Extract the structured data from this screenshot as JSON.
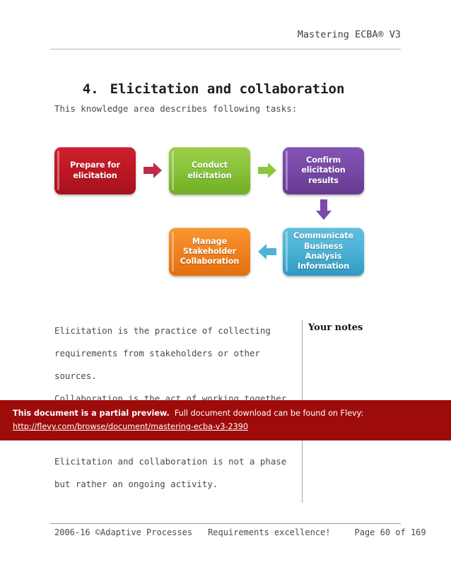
{
  "header": {
    "title": "Mastering ECBA® V3"
  },
  "heading": {
    "number": "4.",
    "text": "Elicitation and collaboration"
  },
  "intro": "This knowledge area describes following tasks:",
  "diagram": {
    "nodes": [
      {
        "id": "prepare-for-elicitation",
        "label": "Prepare for\nelicitation",
        "color": "#c21824"
      },
      {
        "id": "conduct-elicitation",
        "label": "Conduct\nelicitation",
        "color": "#8cc63f"
      },
      {
        "id": "confirm-elicitation-results",
        "label": "Confirm\nelicitation results",
        "color": "#7a4aa8"
      },
      {
        "id": "manage-stakeholder-collaboration",
        "label": "Manage\nStakeholder\nCollaboration",
        "color": "#f28322"
      },
      {
        "id": "communicate-business-analysis-information",
        "label": "Communicate\nBusiness Analysis\nInformation",
        "color": "#4eb3d6"
      }
    ],
    "arrows": [
      {
        "id": "arrow-prepare-to-conduct",
        "direction": "right",
        "color": "#c2294a"
      },
      {
        "id": "arrow-conduct-to-confirm",
        "direction": "right",
        "color": "#8cc63f"
      },
      {
        "id": "arrow-confirm-to-communicate",
        "direction": "down",
        "color": "#7a4aa8"
      },
      {
        "id": "arrow-communicate-to-manage",
        "direction": "left",
        "color": "#4eb3d6"
      }
    ]
  },
  "body": {
    "paragraph1": "Elicitation is the practice of collecting\nrequirements from stakeholders or other\nsources.",
    "paragraph2": "Collaboration is the act of working together",
    "paragraph3": "Elicitation and collaboration is not a phase\nbut rather an ongoing activity."
  },
  "notes": {
    "title": "Your notes"
  },
  "banner": {
    "strong_text": "This document is a partial preview.",
    "rest_text": "  Full document download can be found on Flevy:",
    "url": "http://flevy.com/browse/document/mastering-ecba-v3-2390",
    "background": "#9e0b0b"
  },
  "footer": {
    "copyright": "2006-16 ©Adaptive Processes",
    "tagline": "Requirements excellence!",
    "page": "Page 60 of 169"
  }
}
